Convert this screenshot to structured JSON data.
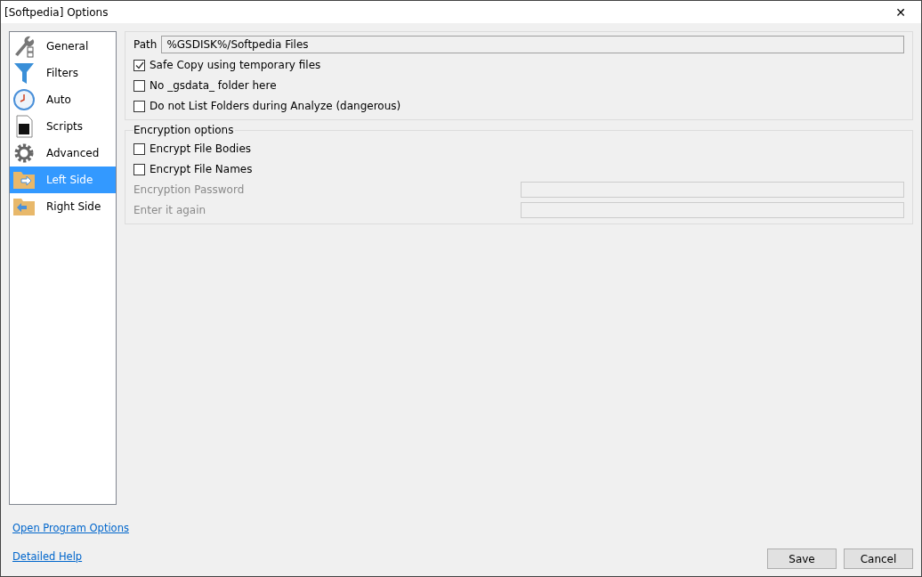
{
  "window": {
    "title": "[Softpedia] Options",
    "close": "✕"
  },
  "sidebar": {
    "items": [
      {
        "label": "General",
        "selected": false
      },
      {
        "label": "Filters",
        "selected": false
      },
      {
        "label": "Auto",
        "selected": false
      },
      {
        "label": "Scripts",
        "selected": false
      },
      {
        "label": "Advanced",
        "selected": false
      },
      {
        "label": "Left Side",
        "selected": true
      },
      {
        "label": "Right Side",
        "selected": false
      }
    ]
  },
  "path": {
    "label": "Path",
    "value": "%GSDISK%/Softpedia Files"
  },
  "options": [
    {
      "label": "Safe Copy using temporary files",
      "checked": true
    },
    {
      "label": "No _gsdata_ folder here",
      "checked": false
    },
    {
      "label": "Do not List Folders during Analyze (dangerous)",
      "checked": false
    }
  ],
  "encryption": {
    "title": "Encryption options",
    "options": [
      {
        "label": "Encrypt File Bodies",
        "checked": false
      },
      {
        "label": "Encrypt File Names",
        "checked": false
      }
    ],
    "fields": [
      {
        "label": "Encryption Password",
        "disabled": true
      },
      {
        "label": "Enter it again",
        "disabled": true
      }
    ]
  },
  "links": [
    "Open Program Options",
    "Detailed Help"
  ],
  "buttons": [
    "Save",
    "Cancel"
  ]
}
